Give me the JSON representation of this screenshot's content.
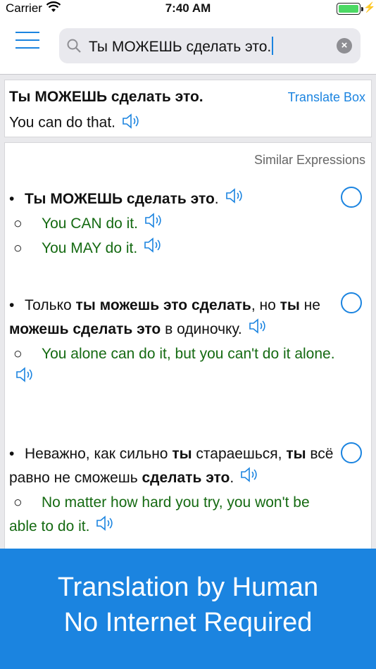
{
  "status": {
    "carrier": "Carrier",
    "time": "7:40 AM"
  },
  "search": {
    "text": "Ты МОЖЕШЬ сделать это."
  },
  "top": {
    "source": "Ты МОЖЕШЬ сделать это.",
    "translation": "You can do that.",
    "translate_box_label": "Translate Box"
  },
  "list": {
    "header": "Similar Expressions",
    "entries": [
      {
        "src_html": "<span class=\"bullet\">•</span><b>Ты МОЖЕШЬ сделать это</b>.",
        "translations": [
          "You CAN do it.",
          "You MAY do it."
        ]
      },
      {
        "src_html": "<span class=\"bullet\">•</span>Только <b>ты можешь это сделать</b>, но <b>ты</b> не <b>можешь сделать это</b> в одиночку.",
        "translations": [
          "You alone can do it, but you can't do it alone."
        ]
      },
      {
        "src_html": "<span class=\"bullet\">•</span>Неважно, как сильно <b>ты</b> стараешься, <b>ты</b> всё равно не сможешь <b>сделать это</b>.",
        "translations": [
          "No matter how hard you try, you won't be able to do it."
        ]
      }
    ]
  },
  "banner": {
    "line1": "Translation by Human",
    "line2": "No Internet Required"
  },
  "colors": {
    "accent": "#1b84e0",
    "translation_text": "#156a12",
    "banner_bg": "#1b84e0"
  }
}
